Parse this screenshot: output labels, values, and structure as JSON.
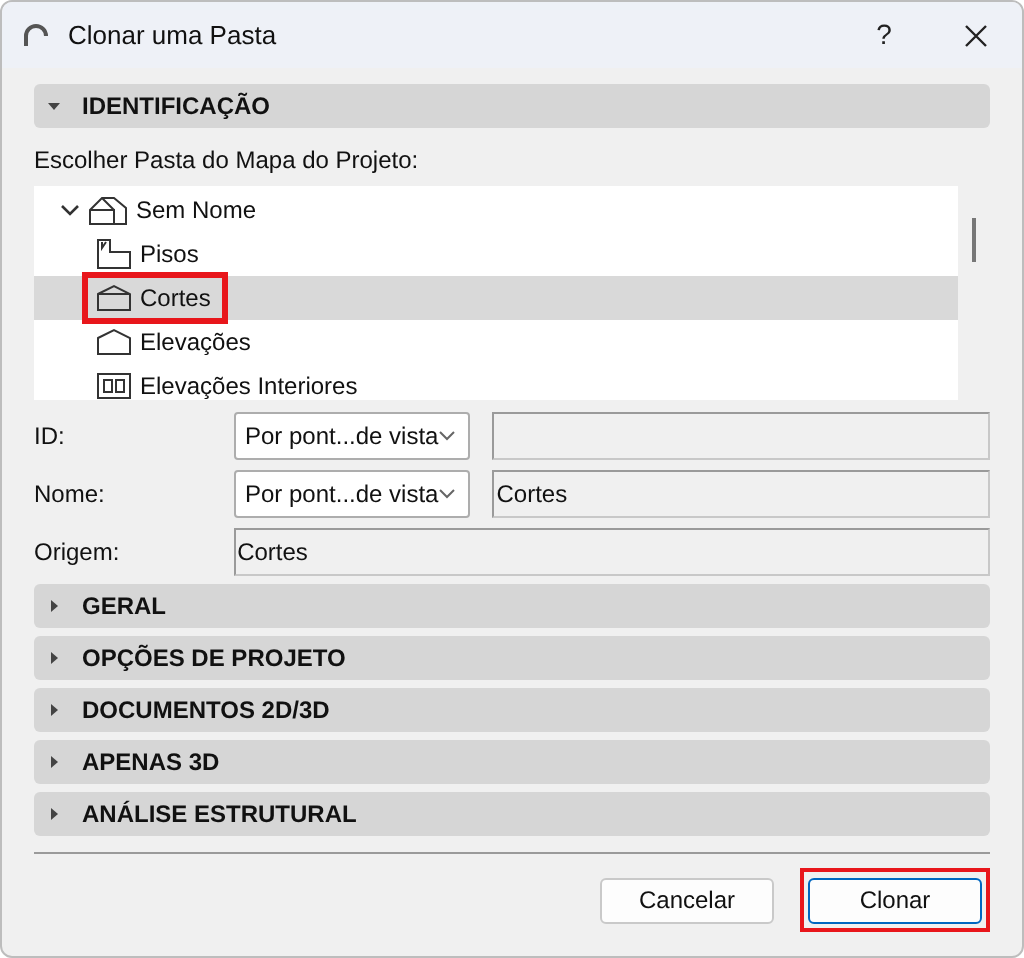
{
  "window": {
    "title": "Clonar uma Pasta",
    "help": "?"
  },
  "identification": {
    "title": "IDENTIFICAÇÃO",
    "expanded": true,
    "tree_label": "Escolher Pasta do Mapa do Projeto:",
    "tree": [
      {
        "label": "Sem Nome",
        "kind": "project",
        "expanded": true,
        "selected": false,
        "highlighted": false,
        "children": [
          {
            "label": "Pisos",
            "kind": "floors",
            "selected": false,
            "highlighted": false
          },
          {
            "label": "Cortes",
            "kind": "section",
            "selected": true,
            "highlighted": true
          },
          {
            "label": "Elevações",
            "kind": "elevation",
            "selected": false,
            "highlighted": false
          },
          {
            "label": "Elevações Interiores",
            "kind": "interior",
            "selected": false,
            "highlighted": false
          }
        ]
      }
    ],
    "fields": [
      {
        "label": "ID:",
        "dropdown": "Por pont...de vista"
      },
      {
        "label": "Nome:",
        "dropdown": "Por pont...de vista",
        "value": "Cortes"
      },
      {
        "label": "Origem:",
        "value": "Cortes"
      }
    ]
  },
  "sections": [
    {
      "title": "GERAL",
      "expanded": false
    },
    {
      "title": "OPÇÕES DE PROJETO",
      "expanded": false
    },
    {
      "title": "DOCUMENTOS 2D/3D",
      "expanded": false
    },
    {
      "title": "APENAS 3D",
      "expanded": false
    },
    {
      "title": "ANÁLISE ESTRUTURAL",
      "expanded": false
    }
  ],
  "buttons": [
    {
      "label": "Cancelar",
      "highlighted": false
    },
    {
      "label": "Clonar",
      "highlighted": true
    }
  ]
}
